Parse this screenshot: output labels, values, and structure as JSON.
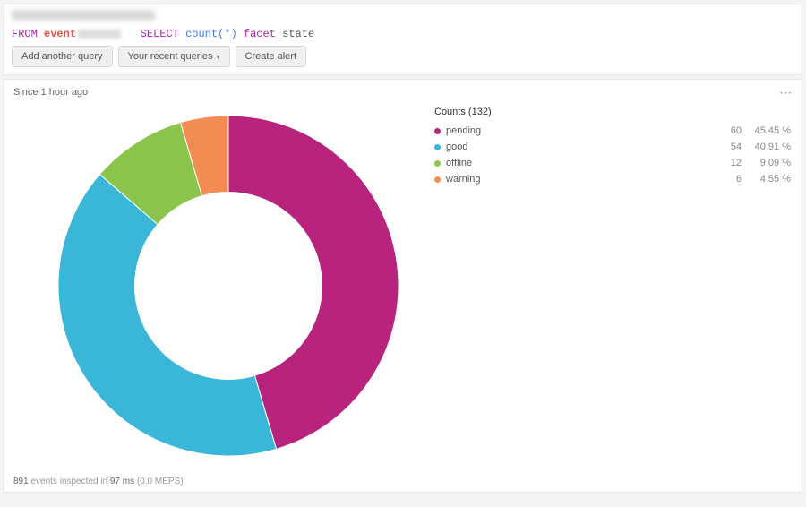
{
  "query": {
    "from_kw": "FROM",
    "event_kw": "event",
    "select_kw": "SELECT",
    "count_kw": "count(*)",
    "facet_kw": "facet",
    "state_kw": "state"
  },
  "toolbar": {
    "add_query": "Add another query",
    "recent_queries": "Your recent queries",
    "create_alert": "Create alert"
  },
  "time_label": "Since 1 hour ago",
  "legend": {
    "title_prefix": "Counts",
    "total": 132
  },
  "chart_data": {
    "type": "pie",
    "title": "Counts (132)",
    "inner_radius_ratio": 0.55,
    "series": [
      {
        "name": "pending",
        "value": 60,
        "percent": 45.45,
        "color": "#b8237e"
      },
      {
        "name": "good",
        "value": 54,
        "percent": 40.91,
        "color": "#39b6d8"
      },
      {
        "name": "offline",
        "value": 12,
        "percent": 9.09,
        "color": "#8ac44b"
      },
      {
        "name": "warning",
        "value": 6,
        "percent": 4.55,
        "color": "#f28c52"
      }
    ]
  },
  "footer": {
    "events": "891",
    "events_label": "events inspected in",
    "time_ms": "97 ms",
    "meps": "(0.0 MEPS)"
  }
}
